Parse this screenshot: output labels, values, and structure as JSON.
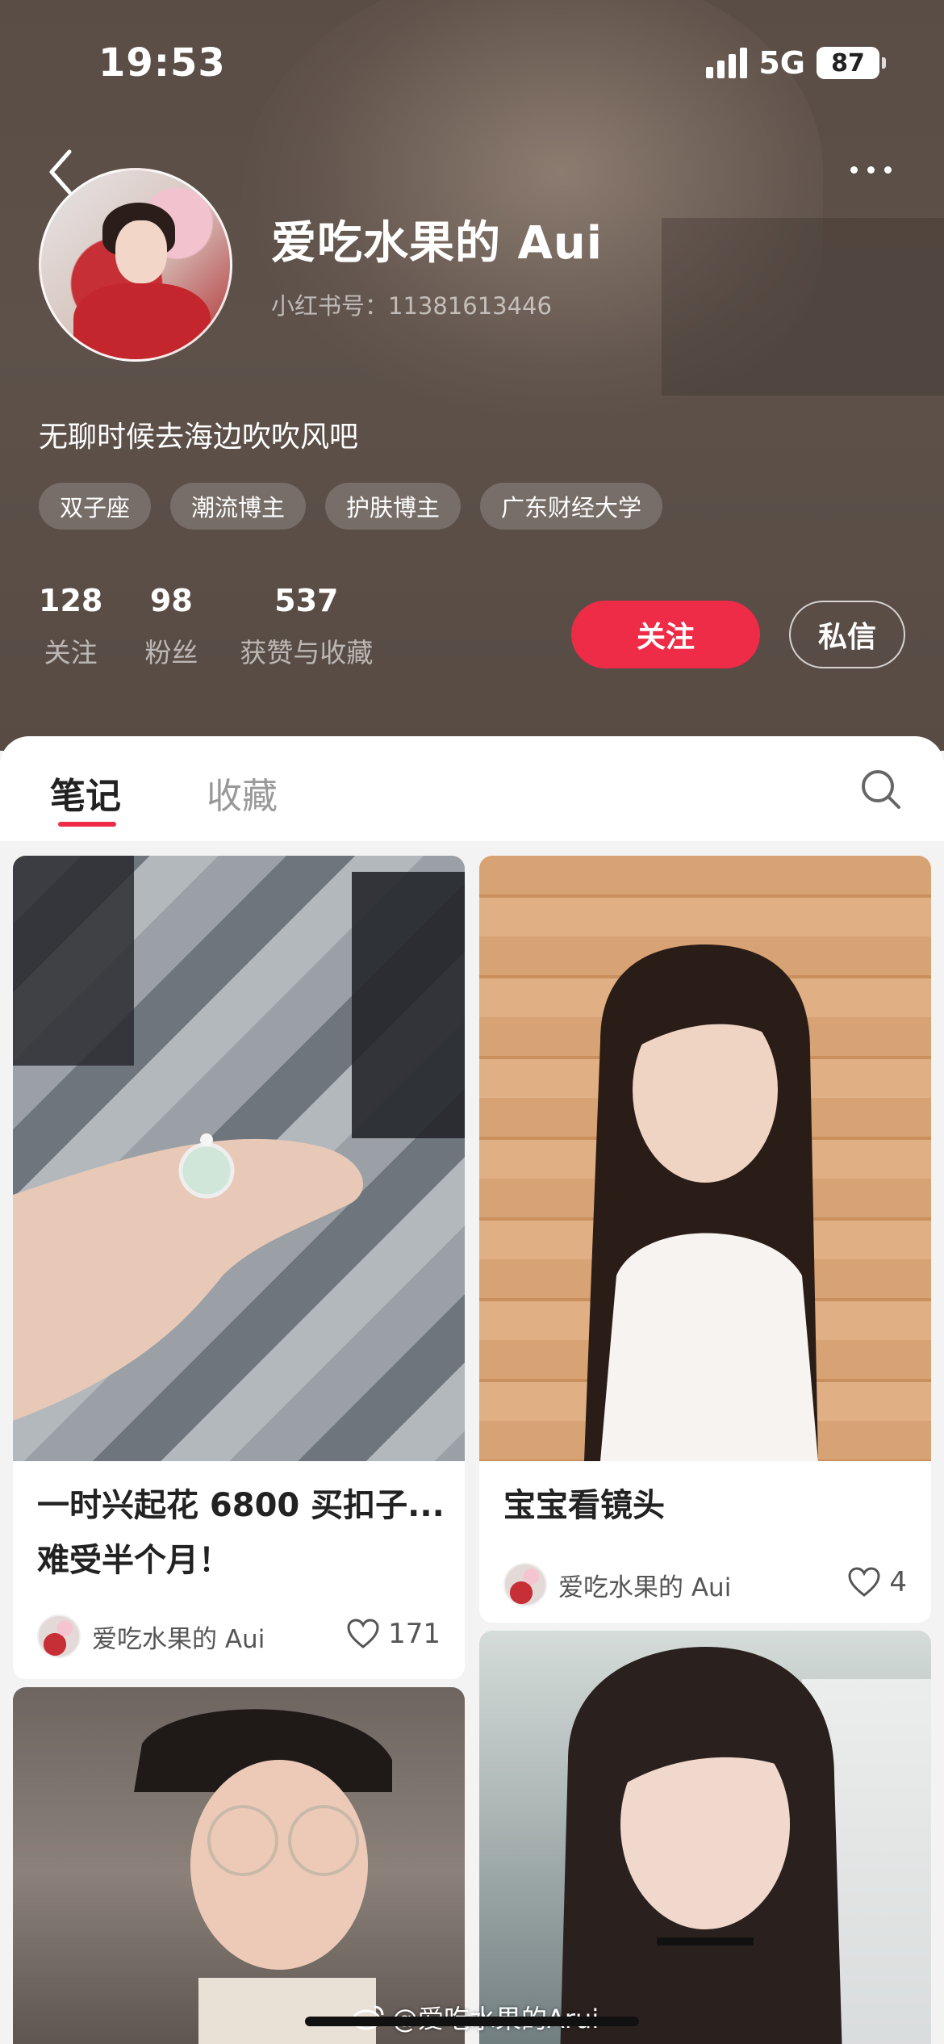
{
  "status_bar": {
    "time": "19:53",
    "network": "5G",
    "battery": "87"
  },
  "profile": {
    "nickname": "爱吃水果的 Aui",
    "user_id": "小红书号：11381613446",
    "bio": "无聊时候去海边吹吹风吧",
    "tags": [
      "双子座",
      "潮流博主",
      "护肤博主",
      "广东财经大学"
    ],
    "stats": [
      {
        "value": "128",
        "label": "关注"
      },
      {
        "value": "98",
        "label": "粉丝"
      },
      {
        "value": "537",
        "label": "获赞与收藏"
      }
    ],
    "follow_label": "关注",
    "message_label": "私信"
  },
  "tabs": {
    "active": "笔记",
    "inactive": "收藏"
  },
  "notes": [
    {
      "title_line1": "一时兴起花 6800 买扣子...",
      "title_line2": "难受半个月！",
      "author": "爱吃水果的 Aui",
      "likes": "171"
    },
    {
      "title_line1": "宝宝看镜头",
      "author": "爱吃水果的 Aui",
      "likes": "4"
    }
  ],
  "watermark": "@爱吃水果的Arui",
  "colors": {
    "accent": "#ee2c47",
    "header_bg": "#5a4d45"
  },
  "icons": [
    "back-icon",
    "more-icon",
    "search-icon",
    "heart-icon",
    "weibo-icon"
  ]
}
